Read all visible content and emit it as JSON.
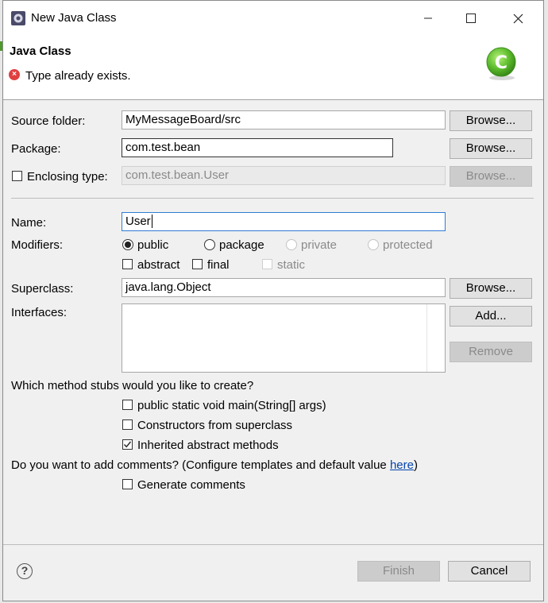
{
  "window": {
    "title": "New Java Class"
  },
  "header": {
    "title": "Java Class",
    "message": "Type already exists."
  },
  "form": {
    "source_folder": {
      "label": "Source folder:",
      "value": "MyMessageBoard/src",
      "browse": "Browse..."
    },
    "package": {
      "label": "Package:",
      "value": "com.test.bean",
      "browse": "Browse..."
    },
    "enclosing_type": {
      "label": "Enclosing type:",
      "value": "com.test.bean.User",
      "browse": "Browse...",
      "checked": false
    },
    "name": {
      "label": "Name:",
      "value": "User"
    },
    "modifiers": {
      "label": "Modifiers:",
      "access": [
        "public",
        "package",
        "private",
        "protected"
      ],
      "selected": "public",
      "flags": [
        "abstract",
        "final",
        "static"
      ]
    },
    "superclass": {
      "label": "Superclass:",
      "value": "java.lang.Object",
      "browse": "Browse..."
    },
    "interfaces": {
      "label": "Interfaces:",
      "add": "Add...",
      "remove": "Remove"
    }
  },
  "stubs": {
    "question": "Which method stubs would you like to create?",
    "options": [
      {
        "label": "public static void main(String[] args)",
        "checked": false
      },
      {
        "label": "Constructors from superclass",
        "checked": false
      },
      {
        "label": "Inherited abstract methods",
        "checked": true
      }
    ]
  },
  "comments": {
    "question_prefix": "Do you want to add comments? (Configure templates and default value ",
    "link": "here",
    "question_suffix": ")",
    "option": {
      "label": "Generate comments",
      "checked": false
    }
  },
  "footer": {
    "help": "?",
    "finish": "Finish",
    "cancel": "Cancel"
  },
  "colors": {
    "accent_green": "#59b530",
    "error_red": "#e04040",
    "focus_blue": "#2f7dd4",
    "link_blue": "#0645ad"
  }
}
